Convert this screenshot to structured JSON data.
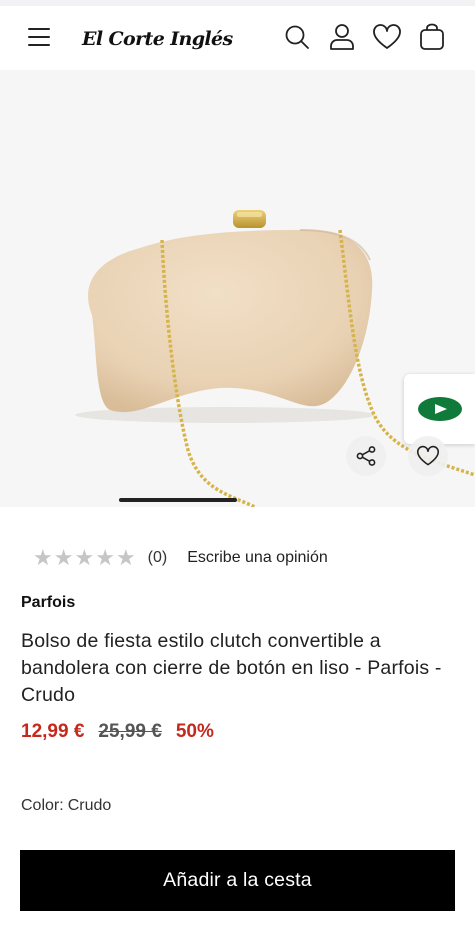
{
  "header": {
    "logo_text": "El Corte Inglés",
    "icons": [
      "menu-icon",
      "search-icon",
      "user-icon",
      "heart-icon",
      "bag-icon"
    ]
  },
  "product": {
    "image_alt": "Bolso de fiesta clutch color crudo con cadena dorada",
    "rating": {
      "stars_filled": 0,
      "stars_total": 5,
      "count": "(0)",
      "write_review": "Escribe una opinión"
    },
    "brand": "Parfois",
    "title": "Bolso de fiesta estilo clutch convertible a bandolera con cierre de botón en liso - Parfois - Crudo",
    "price": {
      "current": "12,99 €",
      "old": "25,99 €",
      "discount": "50%"
    },
    "color": {
      "label": "Color:",
      "value": "Crudo"
    },
    "carousel": {
      "active_index": 1
    }
  },
  "cta": {
    "add_to_cart": "Añadir a la cesta"
  },
  "colors": {
    "accent_red": "#c5281c",
    "brand_green": "#0f7a3a",
    "button_black": "#000000"
  }
}
